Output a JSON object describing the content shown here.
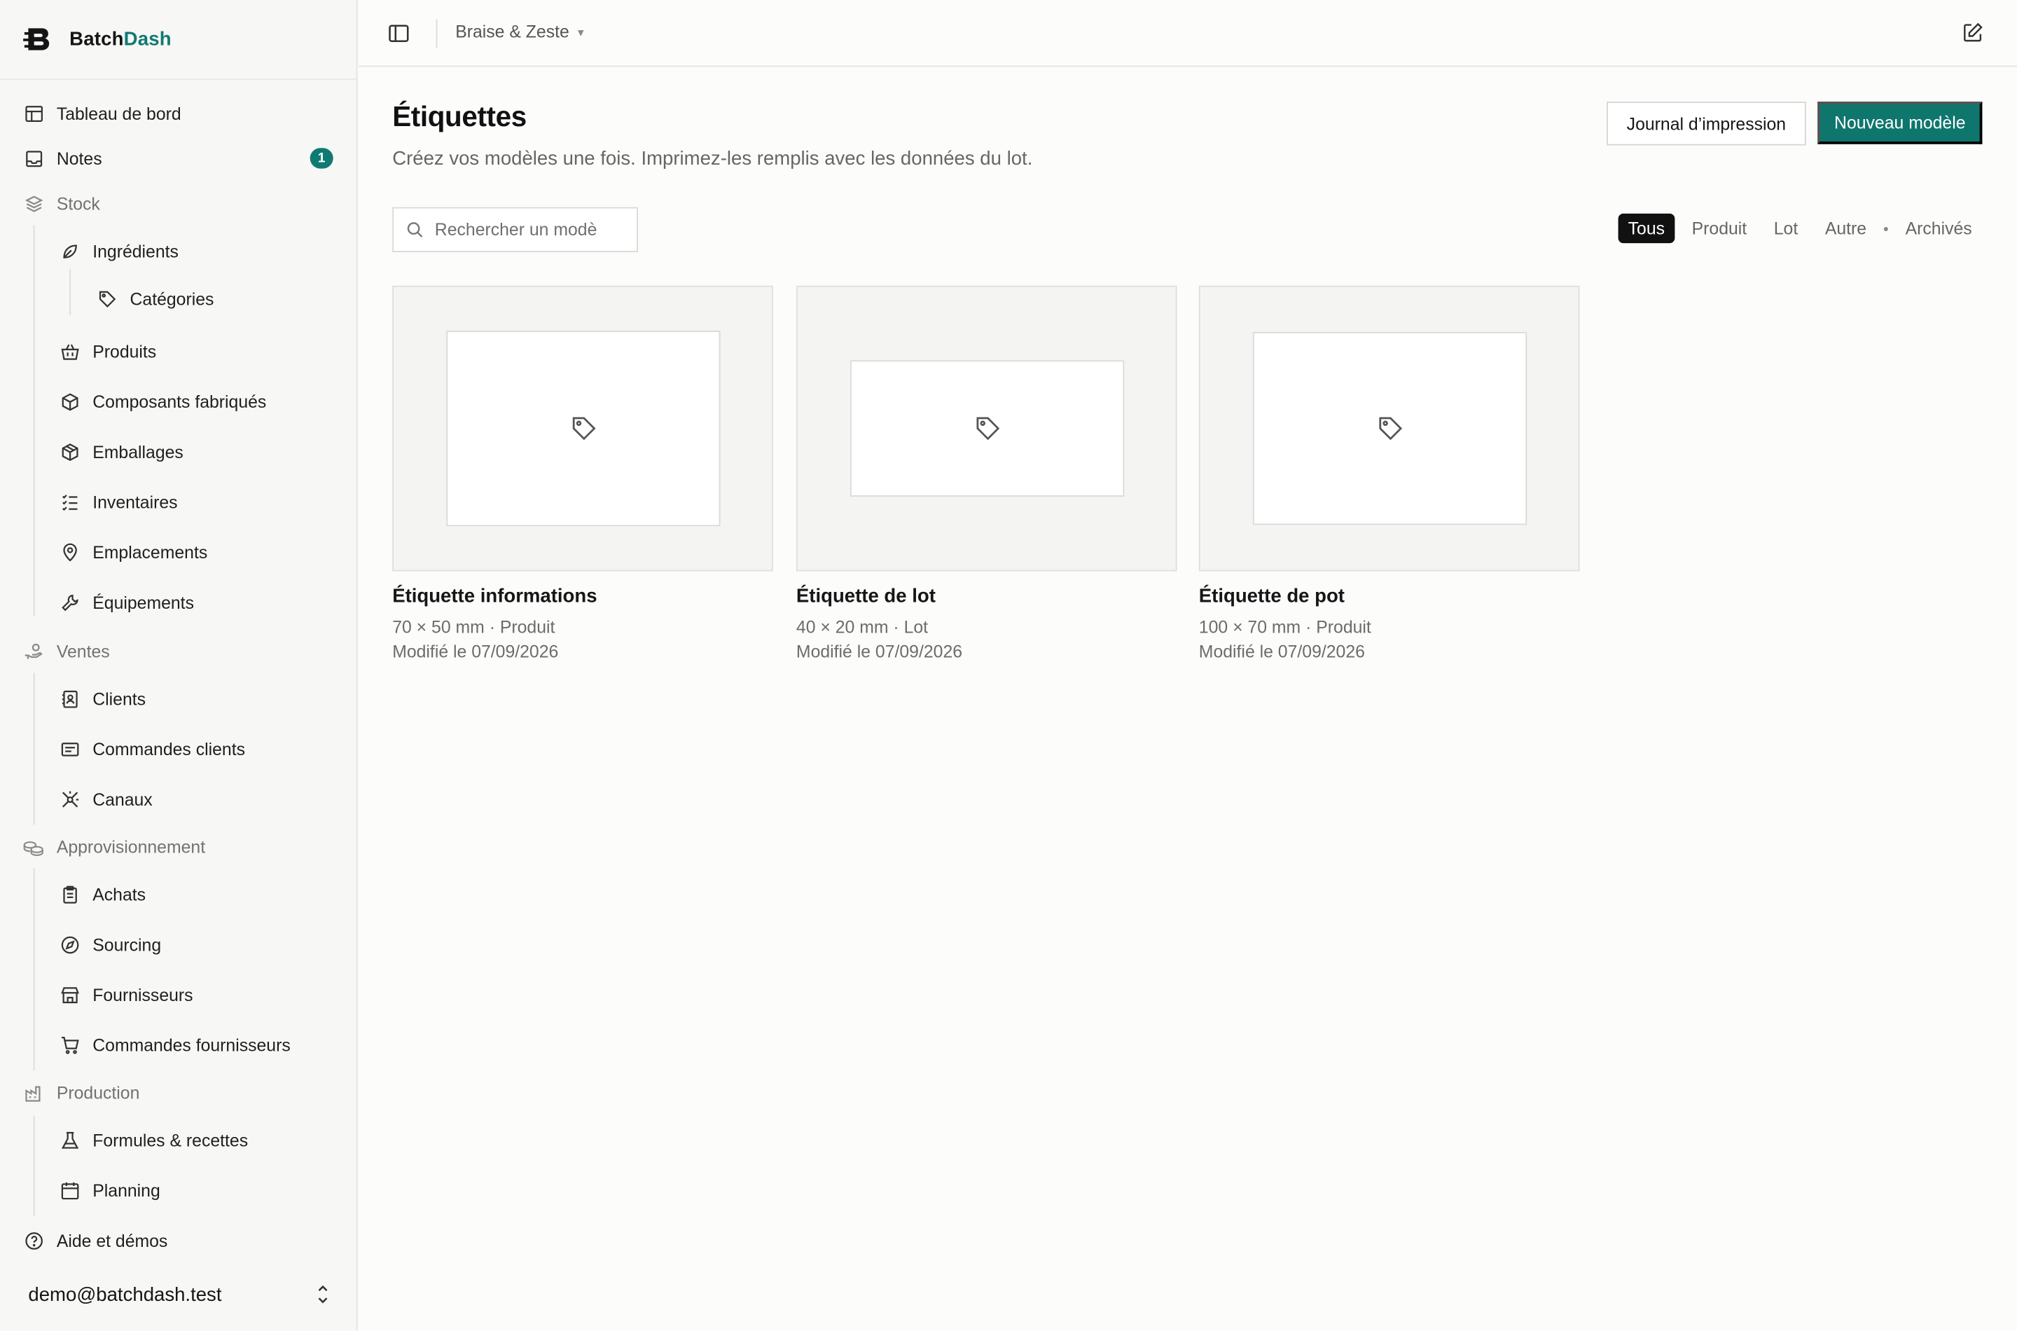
{
  "brand": {
    "name_part1": "Batch",
    "name_part2": "Dash"
  },
  "topbar": {
    "workspace": "Braise & Zeste"
  },
  "sidebar": {
    "items": [
      {
        "label": "Tableau de bord"
      },
      {
        "label": "Notes",
        "badge": "1"
      },
      {
        "label": "Stock"
      },
      {
        "label": "Ingrédients"
      },
      {
        "label": "Catégories"
      },
      {
        "label": "Produits"
      },
      {
        "label": "Composants fabriqués"
      },
      {
        "label": "Emballages"
      },
      {
        "label": "Inventaires"
      },
      {
        "label": "Emplacements"
      },
      {
        "label": "Équipements"
      },
      {
        "label": "Ventes"
      },
      {
        "label": "Clients"
      },
      {
        "label": "Commandes clients"
      },
      {
        "label": "Canaux"
      },
      {
        "label": "Approvisionnement"
      },
      {
        "label": "Achats"
      },
      {
        "label": "Sourcing"
      },
      {
        "label": "Fournisseurs"
      },
      {
        "label": "Commandes fournisseurs"
      },
      {
        "label": "Production"
      },
      {
        "label": "Formules & recettes"
      },
      {
        "label": "Planning"
      },
      {
        "label": "Aide et démos"
      }
    ],
    "user_email": "demo@batchdash.test"
  },
  "page": {
    "title": "Étiquettes",
    "subtitle": "Créez vos modèles une fois. Imprimez-les remplis avec les données du lot.",
    "print_log_label": "Journal d’impression",
    "new_template_label": "Nouveau modèle",
    "search_placeholder": "Rechercher un modè",
    "filters": [
      "Tous",
      "Produit",
      "Lot",
      "Autre",
      "Archivés"
    ],
    "active_filter": "Tous"
  },
  "templates": [
    {
      "name": "Étiquette informations",
      "size_type": "70 × 50 mm · Produit",
      "modified": "Modifié le 07/09/2026"
    },
    {
      "name": "Étiquette de lot",
      "size_type": "40 × 20 mm · Lot",
      "modified": "Modifié le 07/09/2026"
    },
    {
      "name": "Étiquette de pot",
      "size_type": "100 × 70 mm · Produit",
      "modified": "Modifié le 07/09/2026"
    }
  ],
  "colors": {
    "accent": "#0f766e",
    "active_filter_bg": "#111111"
  }
}
